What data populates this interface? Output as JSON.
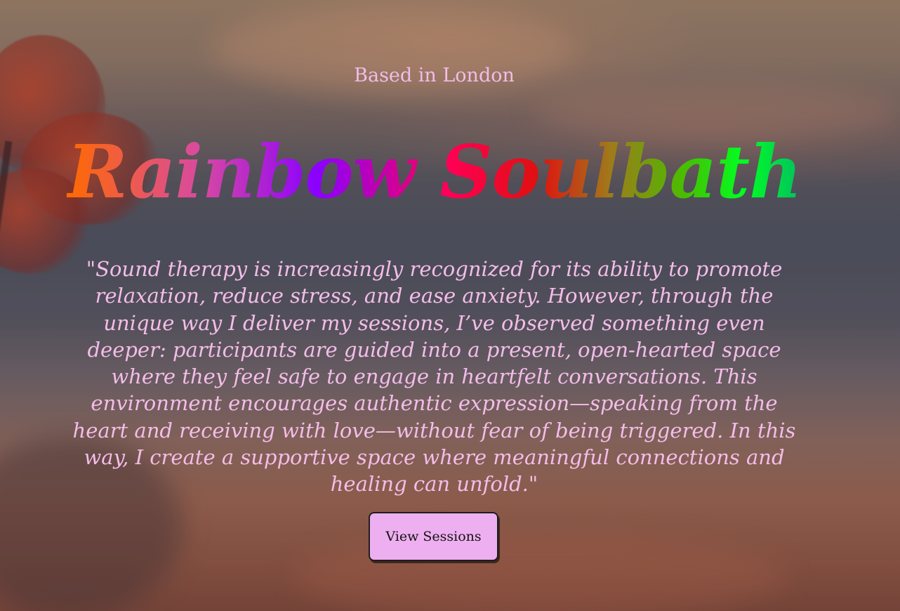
{
  "hero": {
    "tagline": "Based in London",
    "brand_title": "Rainbow Soulbath",
    "quote": "\"Sound therapy is increasingly recognized for its ability to promote relaxation, reduce stress, and ease anxiety. However, through the unique way I deliver my sessions, I’ve observed something even deeper: participants are guided into a present, open-hearted space where they feel safe to engage in heartfelt conversations. This environment encourages authentic expression—speaking from the heart and receiving with love—without fear of being triggered. In this way, I create a supportive space where meaningful connections and healing can unfold.\"",
    "cta_label": "View Sessions"
  },
  "colors": {
    "text_pink": "#f4bde9",
    "button_bg": "#eeaff0",
    "brand_gradient": [
      "#ff6a00",
      "#d94aa0",
      "#8a00ff",
      "#ff0055",
      "#e01010",
      "#a07a1a",
      "#4abd00",
      "#00ff22",
      "#00c060"
    ]
  }
}
